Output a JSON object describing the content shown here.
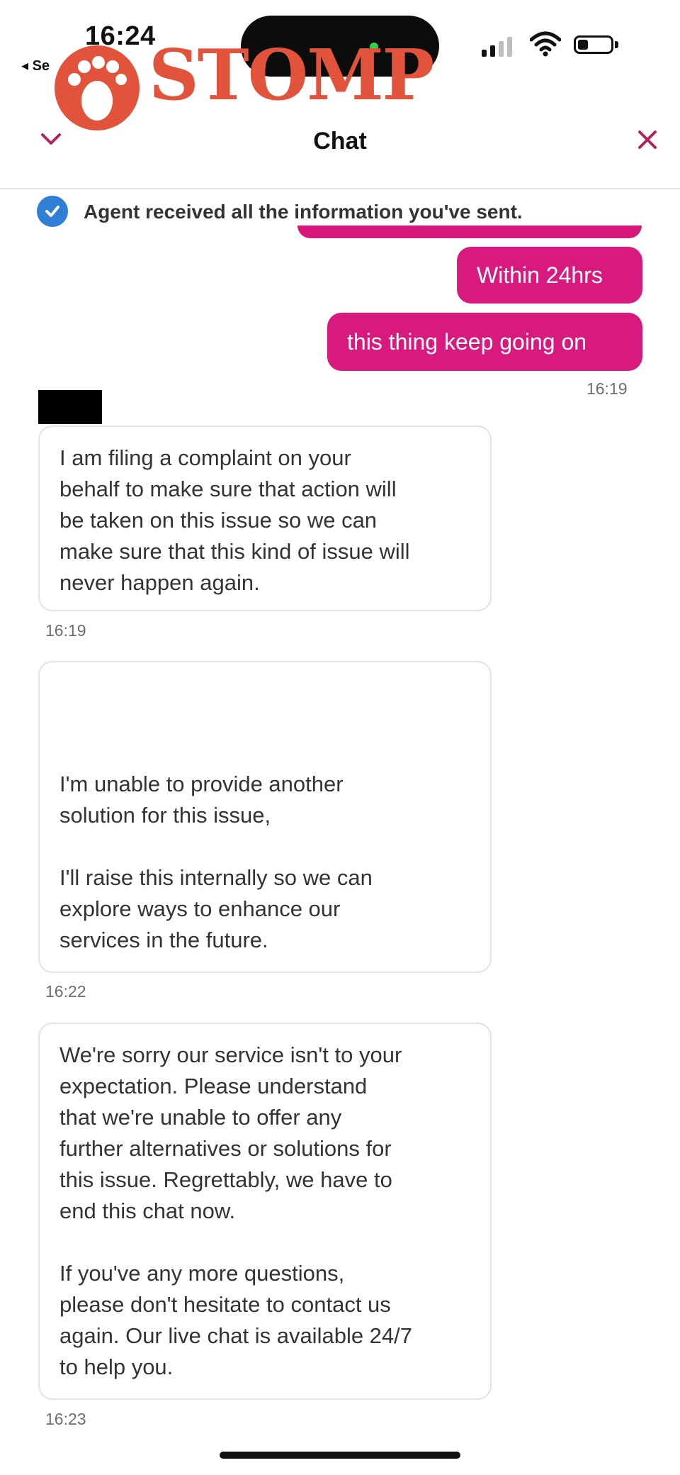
{
  "status_bar": {
    "time": "16:24",
    "back_label": "◂ Se"
  },
  "watermark": {
    "brand": "STOMP",
    "color": "#e2533b"
  },
  "header": {
    "title": "Chat",
    "collapse_icon": "chevron-down-icon",
    "close_icon": "close-icon",
    "accent": "#c2185b"
  },
  "notice": {
    "icon": "check-circle-icon",
    "text": "Agent received all the information you've sent."
  },
  "messages": {
    "outgoing": [
      {
        "text": "Within 24hrs"
      },
      {
        "text": "this thing keep going on"
      }
    ],
    "outgoing_time": "16:19",
    "outgoing_color": "#d81a7e",
    "incoming": [
      {
        "text": "I am filing a complaint on your\nbehalf to make sure that action will\nbe taken on this issue so we can\nmake sure that this kind of issue will\nnever happen again.",
        "time": "16:19"
      },
      {
        "text": " I'm unable to provide another\nsolution for this issue,\n\nI'll raise this internally so we can\nexplore ways to enhance our\nservices in the future.",
        "time": "16:22"
      },
      {
        "text": "We're sorry our service isn't to your\nexpectation. Please understand\nthat we're unable to offer any\nfurther alternatives or solutions for\nthis issue. Regrettably, we have to\nend this chat now.\n\nIf you've any more questions,\nplease don't hesitate to contact us\nagain. Our live chat is available 24/7\nto help you.",
        "time": "16:23"
      }
    ]
  }
}
